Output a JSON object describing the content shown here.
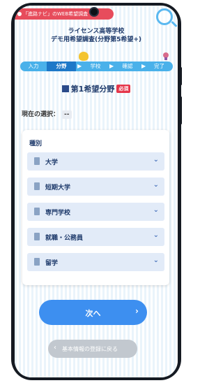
{
  "banner": {
    "text": "「進路ナビ」のWEB希望調査"
  },
  "header": {
    "title_line1": "ライセンス高等学校",
    "title_line2": "デモ用希望調査(分野第5希望+)"
  },
  "steps": [
    {
      "label": "入力",
      "active": false
    },
    {
      "label": "分野",
      "active": true
    },
    {
      "label": "学校",
      "active": false
    },
    {
      "label": "確認",
      "active": false
    },
    {
      "label": "完了",
      "active": false
    }
  ],
  "section": {
    "heading": "第1希望分野",
    "required_badge": "必須"
  },
  "current_selection": {
    "label": "現在の選択：",
    "value": "--"
  },
  "category_card": {
    "title": "種別",
    "options": [
      "大学",
      "短期大学",
      "専門学校",
      "就職・公務員",
      "留学"
    ]
  },
  "buttons": {
    "next_label": "次へ",
    "back_label": "基本情報の登録に戻る"
  },
  "colors": {
    "primary": "#3d8ff0",
    "accent": "#4ab1ea",
    "required": "#e5364a"
  }
}
